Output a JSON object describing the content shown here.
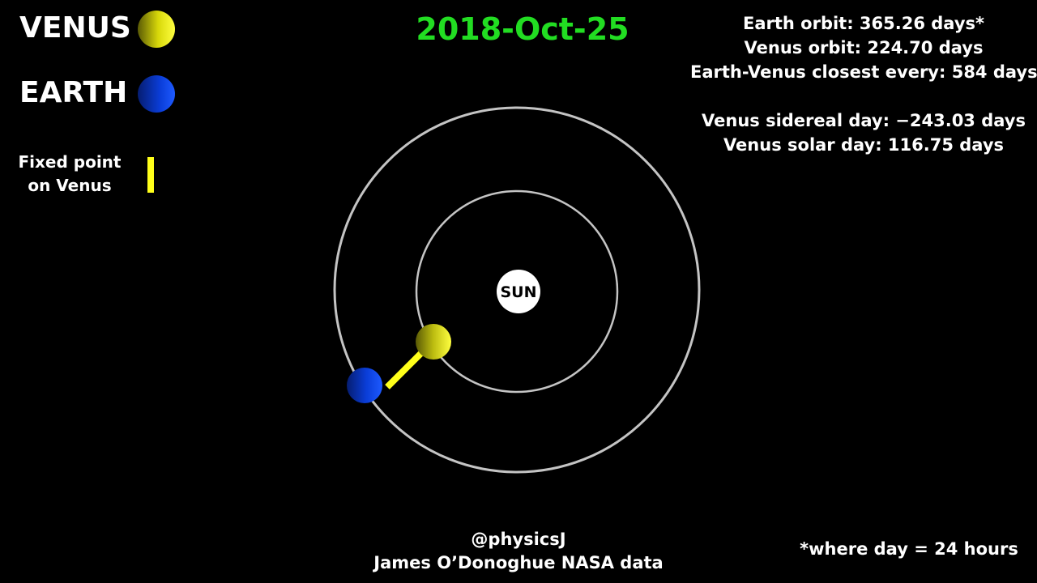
{
  "legend": {
    "venus_label": "VENUS",
    "earth_label": "EARTH",
    "fixed_point_label": "Fixed point\non Venus"
  },
  "date": "2018-Oct-25",
  "stats": {
    "earth_orbit": "Earth orbit: 365.26 days*",
    "venus_orbit": "Venus orbit: 224.70 days",
    "closest": "Earth-Venus closest every: 584 days",
    "sidereal_day": "Venus sidereal day: −243.03 days",
    "solar_day": "Venus solar day: 116.75 days"
  },
  "sun_label": "SUN",
  "credit": {
    "handle": "@physicsJ",
    "source": "James O’Donoghue NASA data"
  },
  "footnote": "*where day = 24 hours",
  "colors": {
    "background": "#000000",
    "date": "#22dd22",
    "venus": "#d8d80a",
    "earth": "#0a3dd8",
    "fixed_point": "#ffff1a",
    "orbit": "#c4c4c4",
    "sun": "#ffffff"
  }
}
